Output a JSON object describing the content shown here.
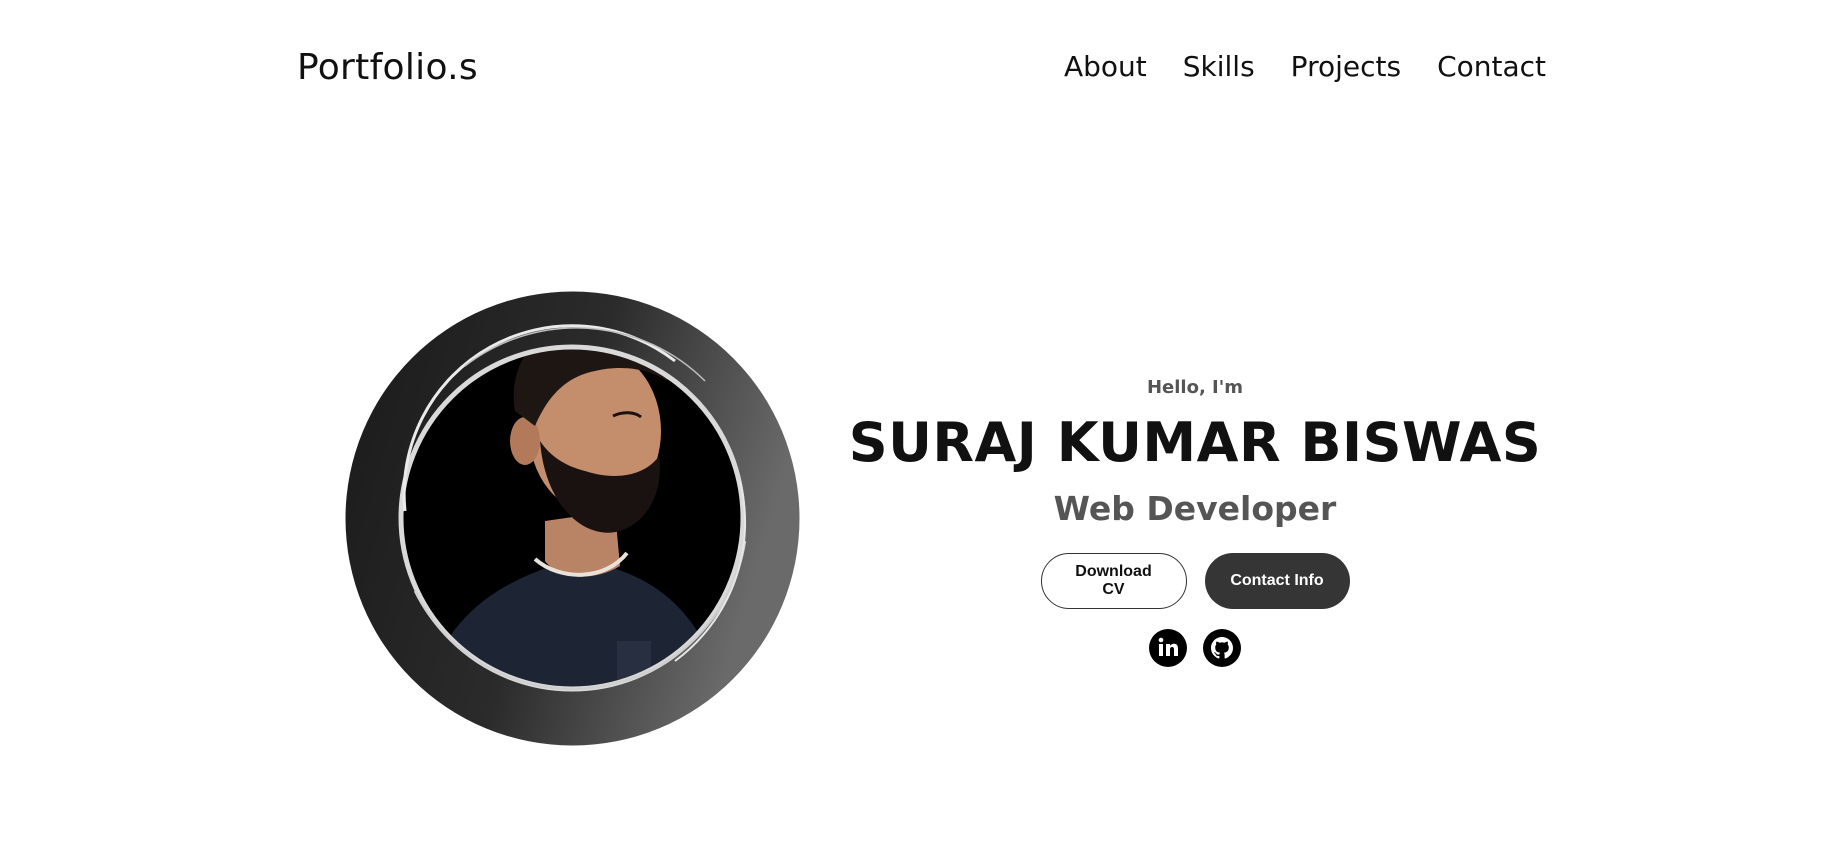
{
  "header": {
    "logo": "Portfolio.s",
    "nav": [
      {
        "label": "About"
      },
      {
        "label": "Skills"
      },
      {
        "label": "Projects"
      },
      {
        "label": "Contact"
      }
    ]
  },
  "hero": {
    "greeting": "Hello, I'm",
    "name": "SURAJ KUMAR BISWAS",
    "role": "Web Developer",
    "buttons": {
      "download": "Download CV",
      "contact": "Contact Info"
    },
    "social": [
      {
        "icon": "linkedin-icon"
      },
      {
        "icon": "github-icon"
      }
    ]
  },
  "colors": {
    "text": "#111111",
    "muted": "#555555",
    "button_dark": "#353535",
    "background": "#ffffff"
  }
}
